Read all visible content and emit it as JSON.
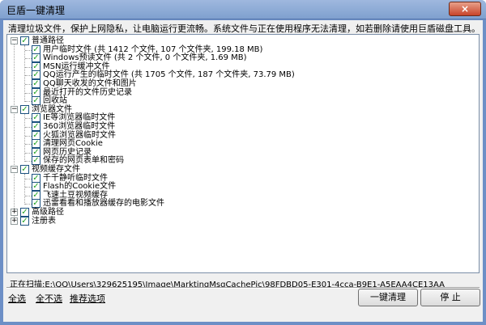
{
  "window": {
    "title": "巨盾一键清理",
    "close_icon": "×"
  },
  "description": "清理垃圾文件，保护上网隐私，让电脑运行更流畅。系统文件与正在使用程序无法清理，如若删除请使用巨盾磁盘工具。",
  "tree": {
    "groups": [
      {
        "label": "普通路径",
        "expander": "−",
        "checked": true,
        "items": [
          "用户临时文件 (共 1412 个文件, 107 个文件夹, 199.18 MB)",
          "Windows预读文件 (共 2 个文件, 0 个文件夹, 1.69 MB)",
          "MSN运行缓冲文件",
          "QQ运行产生的临时文件 (共 1705 个文件, 187 个文件夹, 73.79 MB)",
          "QQ聊天收发的文件和图片",
          "最近打开的文件历史记录",
          "回收站"
        ]
      },
      {
        "label": "浏览器文件",
        "expander": "−",
        "checked": true,
        "items": [
          "IE等浏览器临时文件",
          "360浏览器临时文件",
          "火狐浏览器临时文件",
          "清理网页Cookie",
          "网页历史记录",
          "保存的网页表单和密码"
        ]
      },
      {
        "label": "视频缓存文件",
        "expander": "−",
        "checked": true,
        "items": [
          "千千静听临时文件",
          "Flash的Cookie文件",
          "飞速土豆视频缓存",
          "迅雷看看和播放器缓存的电影文件"
        ]
      },
      {
        "label": "高级路径",
        "expander": "+",
        "checked": true,
        "items": []
      },
      {
        "label": "注册表",
        "expander": "+",
        "checked": true,
        "items": []
      }
    ]
  },
  "scan_status": "正在扫描:E:\\QQ\\Users\\329625195\\Image\\MarktingMsgCachePic\\98FDBD05-E301-4cca-B9E1-A5EAA4CE13AA",
  "footer": {
    "select_all": "全选",
    "select_none": "全不选",
    "recommended": "推荐选项",
    "clean_button": "一键清理",
    "stop_button": "停 止"
  },
  "check_mark": "✓"
}
